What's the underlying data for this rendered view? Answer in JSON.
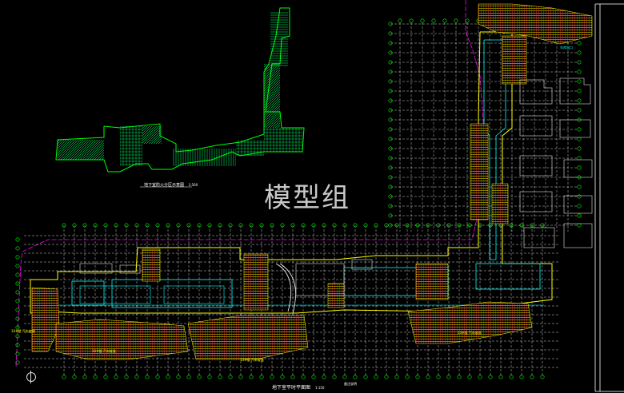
{
  "watermark": "模型组",
  "plans": {
    "fire_partition_title": "地下室防火分区示意图",
    "fire_partition_scale": "1:500",
    "floor_plan_title": "地下室平时平面图",
    "floor_plan_scale": "1:150"
  },
  "room_labels": [
    "10#楼 汽车坡道",
    "10#楼 汽车坡道",
    "13#楼 汽车坡道",
    "13#楼 汽车坡道",
    "车库出口",
    "备注说明"
  ],
  "colors": {
    "background": "#000000",
    "grid": "#ffffff",
    "axis": "#00ff00",
    "wall": "#ffff00",
    "boundary": "#ff00ff",
    "pipe": "#00ffff",
    "area": "#ff3333"
  }
}
